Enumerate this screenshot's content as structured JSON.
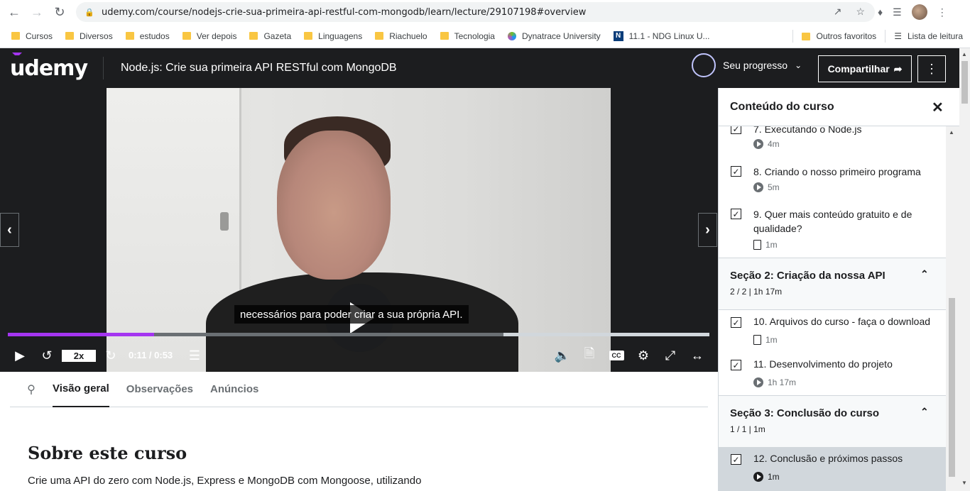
{
  "browser": {
    "url": "udemy.com/course/nodejs-crie-sua-primeira-api-restful-com-mongodb/learn/lecture/29107198#overview",
    "bookmarks": [
      {
        "label": "Cursos",
        "icon": "folder-icon"
      },
      {
        "label": "Diversos",
        "icon": "folder-icon"
      },
      {
        "label": "estudos",
        "icon": "folder-icon"
      },
      {
        "label": "Ver depois",
        "icon": "folder-icon"
      },
      {
        "label": "Gazeta",
        "icon": "folder-icon"
      },
      {
        "label": "Linguagens",
        "icon": "folder-icon"
      },
      {
        "label": "Riachuelo",
        "icon": "folder-icon"
      },
      {
        "label": "Tecnologia",
        "icon": "folder-icon"
      },
      {
        "label": "Dynatrace University",
        "icon": "dynatrace-icon"
      },
      {
        "label": "11.1 - NDG Linux U...",
        "icon": "ndg-icon"
      }
    ],
    "other_bookmarks": "Outros favoritos",
    "reading_list": "Lista de leitura"
  },
  "header": {
    "logo": "udemy",
    "course_title": "Node.js: Crie sua primeira API RESTful com MongoDB",
    "progress_label": "Seu progresso",
    "share_label": "Compartilhar"
  },
  "player": {
    "caption": "necessários para poder criar a sua própria API.",
    "speed": "2x",
    "time": "0:11 / 0:53",
    "progress_fraction": 0.208
  },
  "tabs": {
    "items": [
      "Visão geral",
      "Observações",
      "Anúncios"
    ],
    "active": "Visão geral"
  },
  "about": {
    "title": "Sobre este curso",
    "text": "Crie uma API do zero com Node.js, Express e MongoDB com Mongoose, utilizando"
  },
  "sidebar": {
    "title": "Conteúdo do curso",
    "lectures_top": [
      {
        "title": "7. Executando o Node.js",
        "duration": "4m",
        "type": "video",
        "done": true
      },
      {
        "title": "8. Criando o nosso primeiro programa",
        "duration": "5m",
        "type": "video",
        "done": true
      },
      {
        "title": "9. Quer mais conteúdo gratuito e de qualidade?",
        "duration": "1m",
        "type": "article",
        "done": true
      }
    ],
    "section2": {
      "title": "Seção 2: Criação da nossa API",
      "meta": "2 / 2 | 1h 17m",
      "lectures": [
        {
          "title": "10. Arquivos do curso - faça o download",
          "duration": "1m",
          "type": "article",
          "done": true
        },
        {
          "title": "11. Desenvolvimento do projeto",
          "duration": "1h 17m",
          "type": "video",
          "done": true
        }
      ]
    },
    "section3": {
      "title": "Seção 3: Conclusão do curso",
      "meta": "1 / 1 | 1m",
      "lectures": [
        {
          "title": "12. Conclusão e próximos passos",
          "duration": "1m",
          "type": "video",
          "done": true,
          "current": true
        }
      ]
    }
  },
  "colors": {
    "brand_purple": "#a435f0",
    "header_bg": "#1c1d1f",
    "current_lecture_bg": "#d1d7dc"
  }
}
